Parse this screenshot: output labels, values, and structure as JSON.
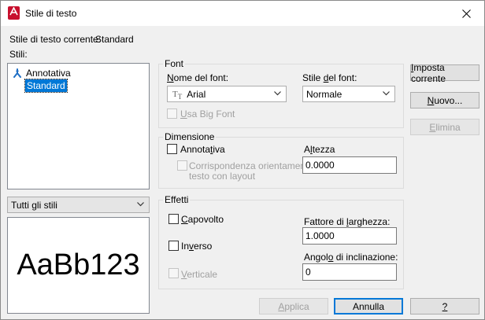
{
  "window": {
    "title": "Stile di testo"
  },
  "current_style": {
    "label": "Stile di testo corrente:",
    "value": "Standard"
  },
  "styles": {
    "label": "Stili:",
    "items": [
      {
        "name": "Annotativa",
        "annotative": true,
        "selected": false
      },
      {
        "name": "Standard",
        "annotative": false,
        "selected": true
      }
    ],
    "filter_value": "Tutti gli stili"
  },
  "preview": {
    "text": "AaBb123"
  },
  "font": {
    "group_title": "Font",
    "name_label": "Nome del font:",
    "name_value": "Arial",
    "style_label": "Stile del font:",
    "style_value": "Normale",
    "bigfont_label": "Usa Big Font"
  },
  "size": {
    "group_title": "Dimensione",
    "annotative_label": "Annotativa",
    "orientation_label_line1": "Corrispondenza orientamento",
    "orientation_label_line2": "testo con layout",
    "height_label": "Altezza",
    "height_value": "0.0000"
  },
  "effects": {
    "group_title": "Effetti",
    "upside_down_label": "Capovolto",
    "backwards_label": "Inverso",
    "vertical_label": "Verticale",
    "width_factor_label": "Fattore di larghezza:",
    "width_factor_value": "1.0000",
    "oblique_label": "Angolo di inclinazione:",
    "oblique_value": "0"
  },
  "buttons": {
    "set_current": "Imposta corrente",
    "new": "Nuovo...",
    "delete": "Elimina",
    "apply": "Applica",
    "cancel": "Annulla",
    "help": "?"
  },
  "colors": {
    "accent": "#0078d7",
    "app_icon": "#c8102e",
    "annotative_icon": "#1f6fc5"
  }
}
